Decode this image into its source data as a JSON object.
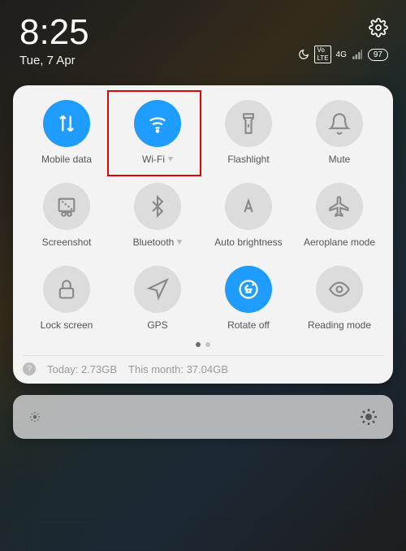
{
  "status": {
    "time": "8:25",
    "date": "Tue, 7 Apr",
    "network_badge": "4G",
    "volte_badge": "VoLTE",
    "battery": "97"
  },
  "tiles": {
    "mobile_data": {
      "label": "Mobile data",
      "active": true
    },
    "wifi": {
      "label": "Wi-Fi",
      "active": true,
      "has_chevron": true,
      "highlighted": true
    },
    "flashlight": {
      "label": "Flashlight",
      "active": false
    },
    "mute": {
      "label": "Mute",
      "active": false
    },
    "screenshot": {
      "label": "Screenshot",
      "active": false
    },
    "bluetooth": {
      "label": "Bluetooth",
      "active": false,
      "has_chevron": true
    },
    "auto_brightness": {
      "label": "Auto brightness",
      "active": false
    },
    "aeroplane": {
      "label": "Aeroplane mode",
      "active": false
    },
    "lock_screen": {
      "label": "Lock screen",
      "active": false
    },
    "gps": {
      "label": "GPS",
      "active": false
    },
    "rotate": {
      "label": "Rotate off",
      "active": true
    },
    "reading": {
      "label": "Reading mode",
      "active": false
    }
  },
  "data_usage": {
    "today_label": "Today:",
    "today_value": "2.73GB",
    "month_label": "This month:",
    "month_value": "37.04GB"
  },
  "colors": {
    "accent": "#1e9cff",
    "highlight": "#e60000"
  }
}
